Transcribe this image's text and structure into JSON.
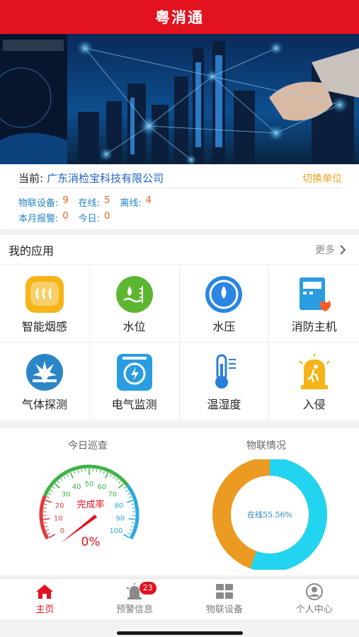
{
  "header": {
    "title": "粤消通"
  },
  "info": {
    "current_label": "当前:",
    "company": "广东消检宝科技有限公司",
    "switch_unit": "切换单位",
    "iot_label": "物联设备:",
    "iot_count": "9",
    "online_label": "在线:",
    "online_count": "5",
    "offline_label": "离线:",
    "offline_count": "4",
    "monthly_alarm_label": "本月报警:",
    "monthly_alarm_count": "0",
    "today_label": "今日:",
    "today_count": "0"
  },
  "apps": {
    "title": "我的应用",
    "more": "更多",
    "items": [
      {
        "label": "智能烟感",
        "icon": "smoke-detector-icon",
        "color": "#f5b417"
      },
      {
        "label": "水位",
        "icon": "water-level-icon",
        "color": "#5db630"
      },
      {
        "label": "水压",
        "icon": "water-pressure-icon",
        "color": "#2a86e2"
      },
      {
        "label": "消防主机",
        "icon": "fire-host-icon",
        "color": "#2a9ce0"
      },
      {
        "label": "气体探测",
        "icon": "gas-detect-icon",
        "color": "#2b86c8"
      },
      {
        "label": "电气监测",
        "icon": "electric-monitor-icon",
        "color": "#2a9de0"
      },
      {
        "label": "温湿度",
        "icon": "thermometer-icon",
        "color": "#2a7fd8"
      },
      {
        "label": "入侵",
        "icon": "intrusion-icon",
        "color": "#f5b417"
      }
    ]
  },
  "patrol": {
    "title": "今日巡查",
    "gauge_label": "完成率",
    "percent": "0%",
    "ticks": [
      "0",
      "10",
      "20",
      "30",
      "40",
      "50",
      "60",
      "70",
      "80",
      "90",
      "100"
    ]
  },
  "iot_status": {
    "title": "物联情况",
    "online_label": "在线55.56%",
    "online_fraction": 0.5556,
    "online_color": "#22d4f0",
    "offline_color": "#eb9a22"
  },
  "tabs": [
    {
      "label": "主页",
      "icon": "home-icon",
      "active": true
    },
    {
      "label": "预警信息",
      "icon": "alarm-icon",
      "badge": "23"
    },
    {
      "label": "物联设备",
      "icon": "devices-icon"
    },
    {
      "label": "个人中心",
      "icon": "user-icon"
    }
  ],
  "colors": {
    "brand": "#e2121f",
    "link": "#1f63c4",
    "accent": "#f0a21a"
  }
}
